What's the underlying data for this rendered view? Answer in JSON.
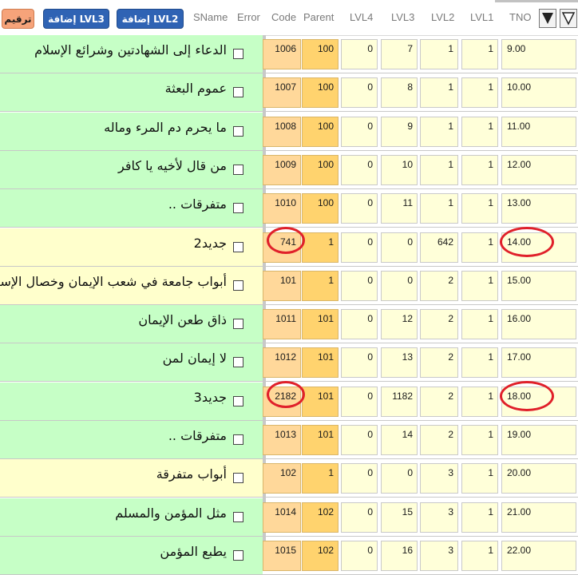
{
  "toolbar": {
    "tarqim_label": "ترقيم",
    "add_lvl3_label": "إضافة LVL3",
    "add_lvl2_label": "إضافة LVL2"
  },
  "columns": {
    "sname": "SName",
    "error": "Error",
    "code": "Code",
    "parent": "Parent",
    "lvl4": "LVL4",
    "lvl3": "LVL3",
    "lvl2": "LVL2",
    "lvl1": "LVL1",
    "tno": "TNO"
  },
  "colors": {
    "green_row": "#c6ffc6",
    "yellow_row": "#ffffcc",
    "cell_bg": "#ffffd9",
    "orange_cell": "#ffd36e",
    "highlight_circle": "#e0202a",
    "button_blue": "#2f63b4",
    "button_orange": "#f6a37a"
  },
  "icons": [
    "sort-ascending-icon",
    "sort-descending-icon"
  ],
  "rows": [
    {
      "sname": "الدعاء إلى الشهادتين وشرائع الإسلام",
      "code": "1006",
      "parent": "100",
      "lvl4": "0",
      "lvl3": "7",
      "lvl2": "1",
      "lvl1": "1",
      "tno": "9.00",
      "color": "green",
      "circled": false
    },
    {
      "sname": "عموم البعثة",
      "code": "1007",
      "parent": "100",
      "lvl4": "0",
      "lvl3": "8",
      "lvl2": "1",
      "lvl1": "1",
      "tno": "10.00",
      "color": "green",
      "circled": false
    },
    {
      "sname": "ما يحرم دم المرء وماله",
      "code": "1008",
      "parent": "100",
      "lvl4": "0",
      "lvl3": "9",
      "lvl2": "1",
      "lvl1": "1",
      "tno": "11.00",
      "color": "green",
      "circled": false
    },
    {
      "sname": "من قال لأخيه يا كافر",
      "code": "1009",
      "parent": "100",
      "lvl4": "0",
      "lvl3": "10",
      "lvl2": "1",
      "lvl1": "1",
      "tno": "12.00",
      "color": "green",
      "circled": false
    },
    {
      "sname": "متفرقات ..",
      "code": "1010",
      "parent": "100",
      "lvl4": "0",
      "lvl3": "11",
      "lvl2": "1",
      "lvl1": "1",
      "tno": "13.00",
      "color": "green",
      "circled": false
    },
    {
      "sname": "جديد2",
      "code": "741",
      "parent": "1",
      "lvl4": "0",
      "lvl3": "0",
      "lvl2": "642",
      "lvl1": "1",
      "tno": "14.00",
      "color": "yellow",
      "circled": true
    },
    {
      "sname": "أبواب جامعة في شعب الإيمان وخصال الإسلام",
      "code": "101",
      "parent": "1",
      "lvl4": "0",
      "lvl3": "0",
      "lvl2": "2",
      "lvl1": "1",
      "tno": "15.00",
      "color": "yellow",
      "circled": false
    },
    {
      "sname": "ذاق طعن الإيمان",
      "code": "1011",
      "parent": "101",
      "lvl4": "0",
      "lvl3": "12",
      "lvl2": "2",
      "lvl1": "1",
      "tno": "16.00",
      "color": "green",
      "circled": false
    },
    {
      "sname": "لا إيمان لمن",
      "code": "1012",
      "parent": "101",
      "lvl4": "0",
      "lvl3": "13",
      "lvl2": "2",
      "lvl1": "1",
      "tno": "17.00",
      "color": "green",
      "circled": false
    },
    {
      "sname": "جديد3",
      "code": "2182",
      "parent": "101",
      "lvl4": "0",
      "lvl3": "1182",
      "lvl2": "2",
      "lvl1": "1",
      "tno": "18.00",
      "color": "green",
      "circled": true
    },
    {
      "sname": "متفرقات ..",
      "code": "1013",
      "parent": "101",
      "lvl4": "0",
      "lvl3": "14",
      "lvl2": "2",
      "lvl1": "1",
      "tno": "19.00",
      "color": "green",
      "circled": false
    },
    {
      "sname": "أبواب متفرقة",
      "code": "102",
      "parent": "1",
      "lvl4": "0",
      "lvl3": "0",
      "lvl2": "3",
      "lvl1": "1",
      "tno": "20.00",
      "color": "yellow",
      "circled": false
    },
    {
      "sname": "مثل المؤمن والمسلم",
      "code": "1014",
      "parent": "102",
      "lvl4": "0",
      "lvl3": "15",
      "lvl2": "3",
      "lvl1": "1",
      "tno": "21.00",
      "color": "green",
      "circled": false
    },
    {
      "sname": "يطبع المؤمن",
      "code": "1015",
      "parent": "102",
      "lvl4": "0",
      "lvl3": "16",
      "lvl2": "3",
      "lvl1": "1",
      "tno": "22.00",
      "color": "green",
      "circled": false
    }
  ]
}
